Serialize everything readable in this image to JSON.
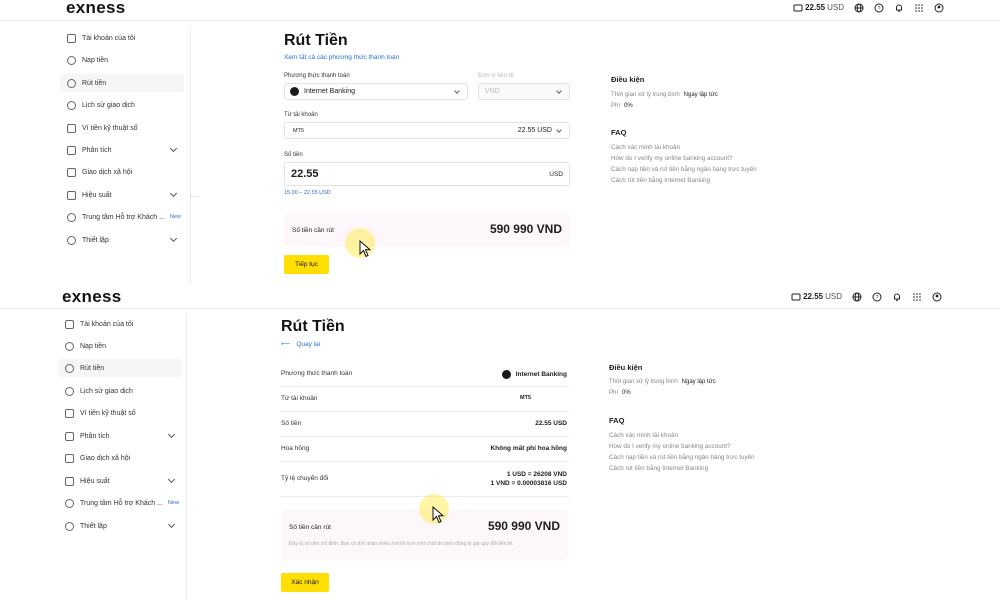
{
  "brand": {
    "logo": "exness",
    "accent": "#ffde02"
  },
  "header": {
    "balance_value": "22.55",
    "balance_currency": "USD"
  },
  "sidebar": {
    "items": [
      {
        "label": "Tài khoản của tôi",
        "icon": "grid-icon"
      },
      {
        "label": "Nạp tiền",
        "icon": "deposit-icon"
      },
      {
        "label": "Rút tiền",
        "icon": "withdraw-icon",
        "active": true
      },
      {
        "label": "Lịch sử giao dịch",
        "icon": "history-icon"
      },
      {
        "label": "Ví tiền kỹ thuật số",
        "icon": "wallet-icon"
      },
      {
        "label": "Phân tích",
        "icon": "analytics-icon",
        "expandable": true
      },
      {
        "label": "Giao dịch xã hội",
        "icon": "social-icon"
      },
      {
        "label": "Hiệu suất",
        "icon": "performance-icon",
        "expandable": true
      },
      {
        "label": "Trung tâm Hỗ trợ Khách ...",
        "icon": "heart-icon",
        "badge": "New"
      },
      {
        "label": "Thiết lập",
        "icon": "settings-icon",
        "expandable": true
      }
    ]
  },
  "form": {
    "title": "Rút Tiền",
    "see_all_link": "Xem tất cả các phương thức thanh toán",
    "method_label": "Phương thức thanh toán",
    "method_value": "Internet Banking",
    "currency_label": "Đơn vị tiền tệ",
    "currency_value": "VND",
    "from_label": "Từ tài khoản",
    "from_account": "MT5",
    "from_balance": "22.55 USD",
    "amount_label": "Số tiền",
    "amount_value": "22.55",
    "amount_currency": "USD",
    "amount_range": "15.00 – 22.55 USD",
    "total_label": "Số tiền cần rút",
    "total_value": "590 990 VND",
    "continue_button": "Tiếp tục"
  },
  "confirm": {
    "title": "Rút Tiền",
    "back_link": "Quay lại",
    "rows": [
      {
        "key": "Phương thức thanh toán",
        "value": "Internet Banking"
      },
      {
        "key": "Từ tài khoản",
        "value": "MT5"
      },
      {
        "key": "Số tiền",
        "value": "22.55 USD"
      },
      {
        "key": "Hoa hồng",
        "value": "Không mất phí hoa hồng"
      },
      {
        "key": "Tỷ lệ chuyển đổi",
        "value": "1 USD = 26208 VND",
        "value2": "1 VND = 0.00003816 USD"
      }
    ],
    "total_label": "Số tiền cần rút",
    "total_value": "590 990 VND",
    "disclaimer": "Đây là số tiền chỉ định. Bạn có thể nhận nhiều hơn/ít hơn một chút do biến động tỷ giá quy đổi tiền tệ.",
    "confirm_button": "Xác nhận"
  },
  "conditions": {
    "heading": "Điều kiện",
    "time_label": "Thời gian xử lý trung bình",
    "time_value": "Ngay lập tức",
    "fee_label": "Phí",
    "fee_value": "0%"
  },
  "faq": {
    "heading": "FAQ",
    "links": [
      "Cách xác minh tài khoản",
      "How do I verify my online banking account?",
      "Cách nạp tiền và rút tiền bằng ngân hàng trực tuyến",
      "Cách rút tiền bằng Internet Banking"
    ]
  }
}
